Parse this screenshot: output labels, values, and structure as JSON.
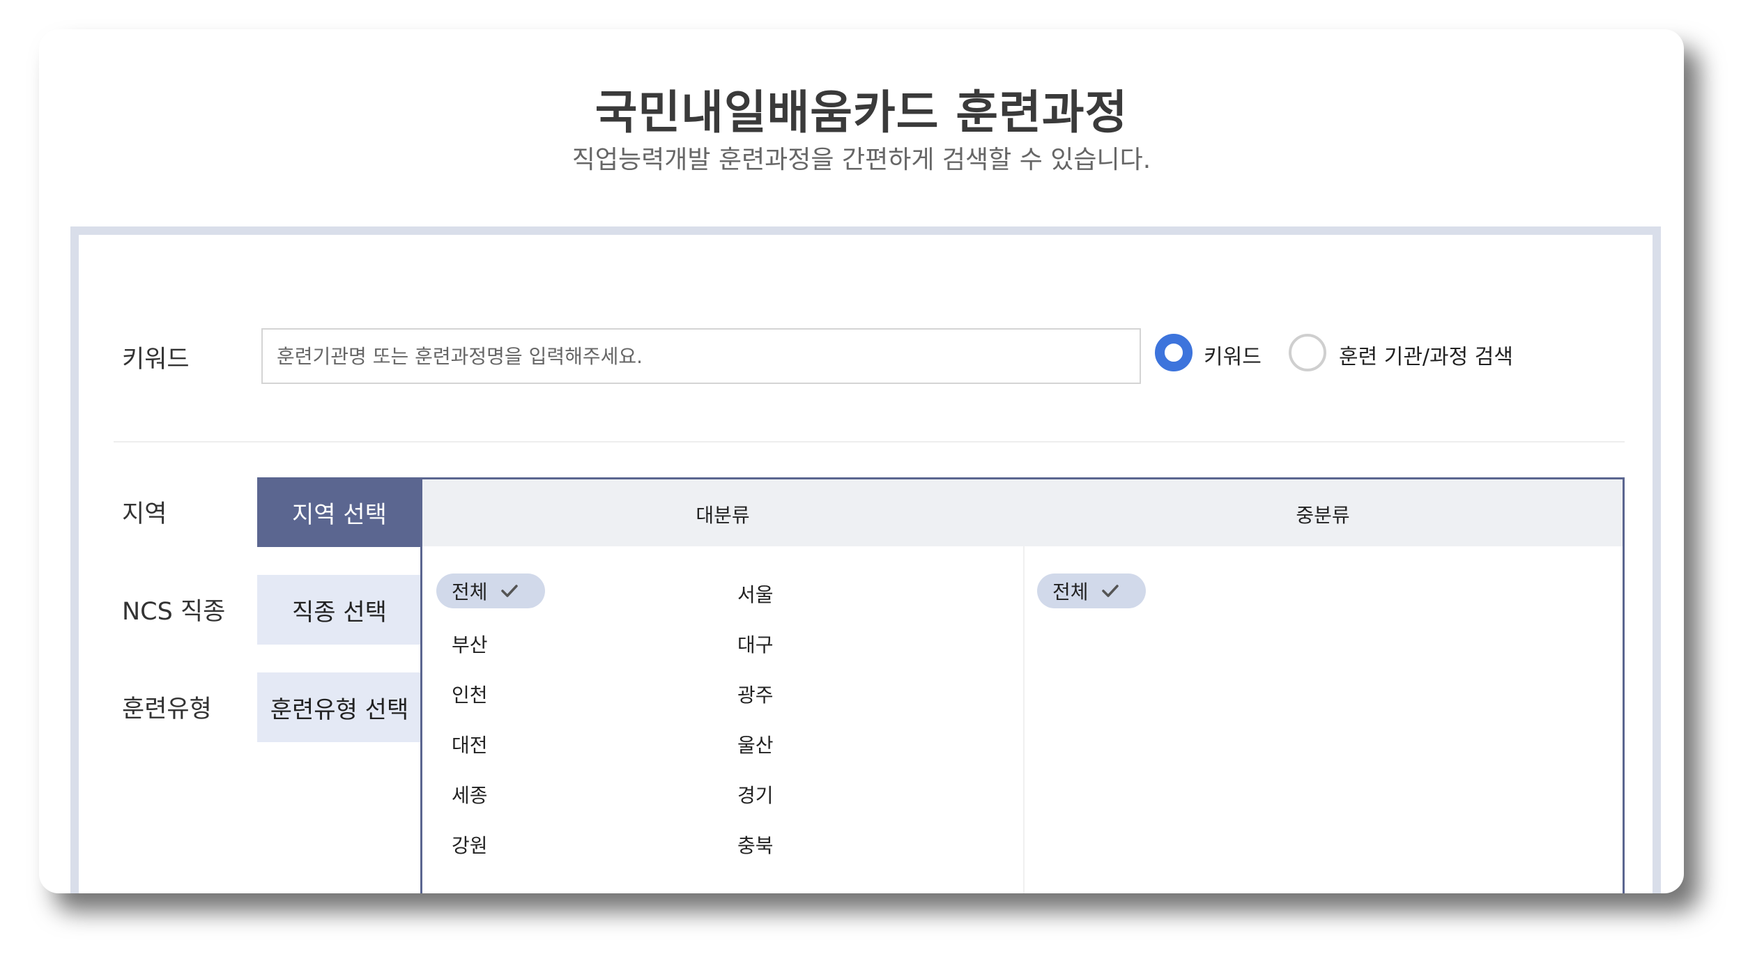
{
  "header": {
    "title": "국민내일배움카드 훈련과정",
    "subtitle": "직업능력개발 훈련과정을 간편하게 검색할 수 있습니다."
  },
  "search": {
    "label": "키워드",
    "placeholder": "훈련기관명 또는 훈련과정명을 입력해주세요.",
    "value": "",
    "radios": [
      {
        "label": "키워드",
        "checked": true
      },
      {
        "label": "훈련 기관/과정 검색",
        "checked": false
      }
    ]
  },
  "filters": {
    "region_label": "지역",
    "ncs_label": "NCS 직종",
    "type_label": "훈련유형",
    "region_button": "지역 선택",
    "ncs_button": "직종 선택",
    "type_button": "훈련유형 선택"
  },
  "categories": {
    "major_header": "대분류",
    "minor_header": "중분류",
    "major_selected": "전체",
    "major_items": [
      "서울",
      "부산",
      "대구",
      "인천",
      "광주",
      "대전",
      "울산",
      "세종",
      "경기",
      "강원",
      "충북"
    ],
    "minor_selected": "전체"
  },
  "colors": {
    "accent": "#3d74dc",
    "active_tab": "#5b6690",
    "inactive_tab": "#e4e9f5",
    "pill": "#d1d9ea",
    "panel_border": "#d9deea"
  },
  "icons": {
    "selected_marker": "check-icon"
  }
}
